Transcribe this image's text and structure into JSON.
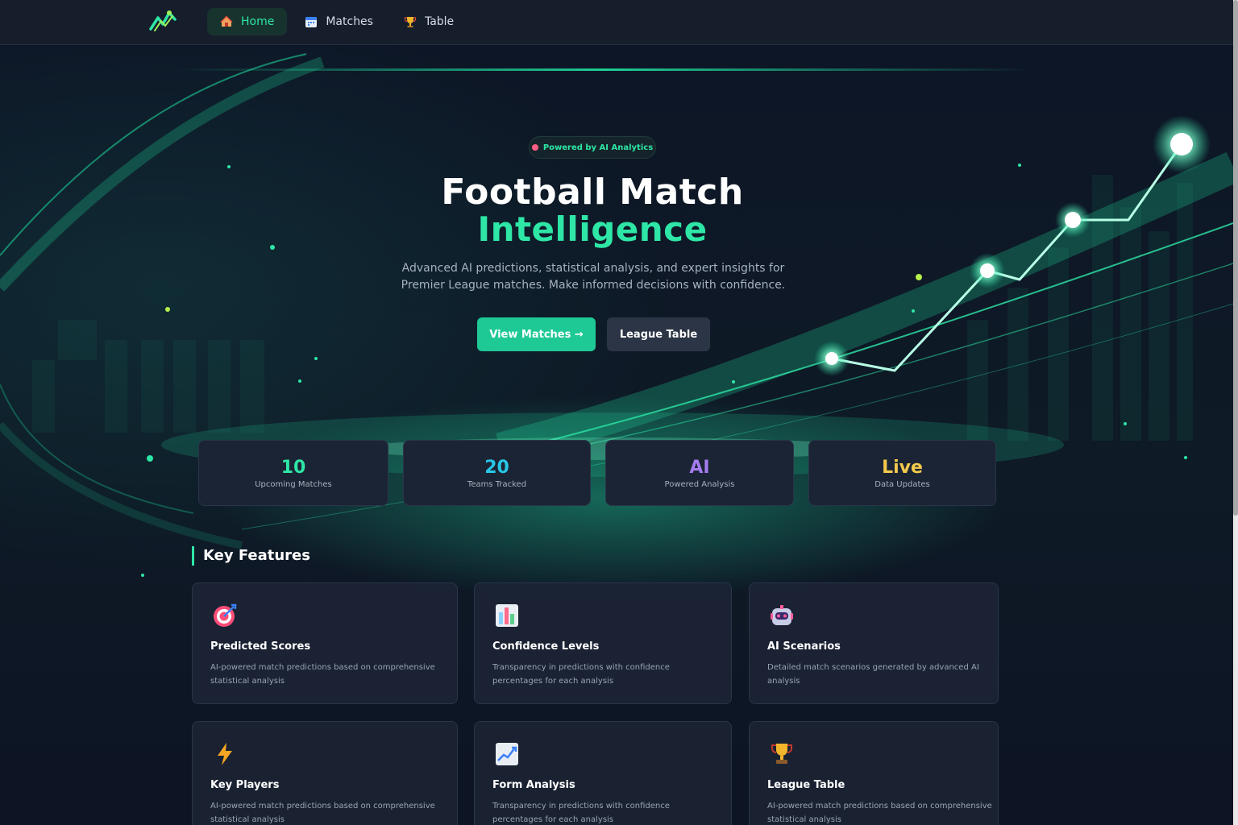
{
  "nav": {
    "logo_icon": "chart-logo-icon",
    "items": [
      {
        "label": "Home",
        "icon": "house-icon",
        "active": true
      },
      {
        "label": "Matches",
        "icon": "calendar-icon",
        "active": false
      },
      {
        "label": "Table",
        "icon": "trophy-icon",
        "active": false
      }
    ]
  },
  "hero": {
    "badge": "Powered by AI Analytics",
    "title_line1": "Football Match",
    "title_line2": "Intelligence",
    "subtitle": "Advanced AI predictions, statistical analysis, and expert insights for Premier League matches. Make informed decisions with confidence.",
    "primary_button": "View Matches →",
    "secondary_button": "League Table"
  },
  "stats": [
    {
      "value": "10",
      "label": "Upcoming Matches",
      "color": "#2ee6a6"
    },
    {
      "value": "20",
      "label": "Teams Tracked",
      "color": "#29c6e6"
    },
    {
      "value": "AI",
      "label": "Powered Analysis",
      "color": "#a37cf0"
    },
    {
      "value": "Live",
      "label": "Data Updates",
      "color": "#f2c94c"
    }
  ],
  "features": {
    "title": "Key Features",
    "cards": [
      {
        "icon": "target-icon",
        "title": "Predicted Scores",
        "desc": "AI-powered match predictions based on comprehensive statistical analysis"
      },
      {
        "icon": "bar-chart-icon",
        "title": "Confidence Levels",
        "desc": "Transparency in predictions with confidence percentages for each analysis"
      },
      {
        "icon": "robot-icon",
        "title": "AI Scenarios",
        "desc": "Detailed match scenarios generated by advanced AI analysis"
      },
      {
        "icon": "lightning-icon",
        "title": "Key Players",
        "desc": "AI-powered match predictions based on comprehensive statistical analysis"
      },
      {
        "icon": "trend-chart-icon",
        "title": "Form Analysis",
        "desc": "Transparency in predictions with confidence percentages for each analysis"
      },
      {
        "icon": "trophy-icon",
        "title": "League Table",
        "desc": "AI-powered match predictions based on comprehensive statistical analysis"
      }
    ]
  }
}
